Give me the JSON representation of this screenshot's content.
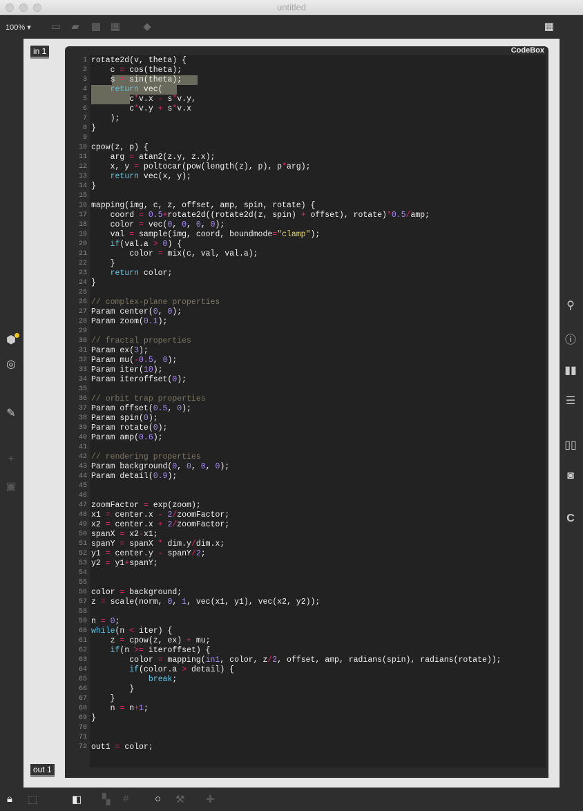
{
  "window": {
    "title": "untitled"
  },
  "toolbar": {
    "zoom": "100%"
  },
  "codebox": {
    "title": "CodeBox"
  },
  "ports": {
    "in": "in 1",
    "out": "out 1"
  },
  "code": [
    "rotate2d(v, theta) {",
    "    c = cos(theta);",
    "    s = sin(theta);",
    "    return vec(",
    "        c*v.x - s*v.y,",
    "        c*v.y + s*v.x",
    "    );",
    "}",
    "",
    "cpow(z, p) {",
    "    arg = atan2(z.y, z.x);",
    "    x, y = poltocar(pow(length(z), p), p*arg);",
    "    return vec(x, y);",
    "}",
    "",
    "mapping(img, c, z, offset, amp, spin, rotate) {",
    "    coord = 0.5+rotate2d((rotate2d(z, spin) + offset), rotate)*0.5/amp;",
    "    color = vec(0, 0, 0, 0);",
    "    val = sample(img, coord, boundmode=\"clamp\");",
    "    if(val.a > 0) {",
    "        color = mix(c, val, val.a);",
    "    }",
    "    return color;",
    "}",
    "",
    "// complex-plane properties",
    "Param center(0, 0);",
    "Param zoom(0.1);",
    "",
    "// fractal properties",
    "Param ex(3);",
    "Param mu(-0.5, 0);",
    "Param iter(10);",
    "Param iteroffset(0);",
    "",
    "// orbit trap properties",
    "Param offset(0.5, 0);",
    "Param spin(0);",
    "Param rotate(0);",
    "Param amp(0.6);",
    "",
    "// rendering properties",
    "Param background(0, 0, 0, 0);",
    "Param detail(0.9);",
    "",
    "",
    "zoomFactor = exp(zoom);",
    "x1 = center.x - 2/zoomFactor;",
    "x2 = center.x + 2/zoomFactor;",
    "spanX = x2-x1;",
    "spanY = spanX * dim.y/dim.x;",
    "y1 = center.y - spanY/2;",
    "y2 = y1+spanY;",
    "",
    "",
    "color = background;",
    "z = scale(norm, 0, 1, vec(x1, y1), vec(x2, y2));",
    "",
    "n = 0;",
    "while(n < iter) {",
    "    z = cpow(z, ex) + mu;",
    "    if(n >= iteroffset) {",
    "        color = mapping(in1, color, z/2, offset, amp, radians(spin), radians(rotate));",
    "        if(color.a > detail) {",
    "            break;",
    "        }",
    "    }",
    "    n = n+1;",
    "}",
    "",
    "",
    "out1 = color;"
  ]
}
